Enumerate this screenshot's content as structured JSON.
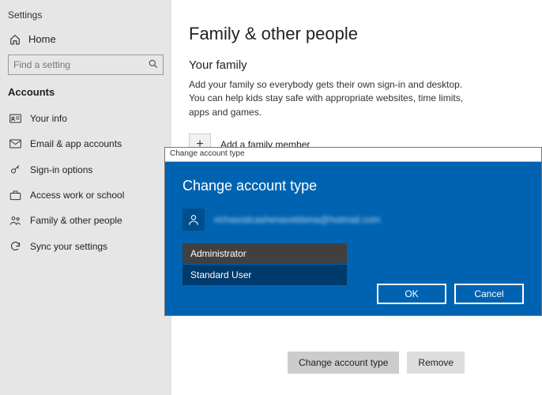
{
  "app_title": "Settings",
  "home_label": "Home",
  "search": {
    "placeholder": "Find a setting"
  },
  "section": "Accounts",
  "nav": [
    {
      "label": "Your info"
    },
    {
      "label": "Email & app accounts"
    },
    {
      "label": "Sign-in options"
    },
    {
      "label": "Access work or school"
    },
    {
      "label": "Family & other people"
    },
    {
      "label": "Sync your settings"
    }
  ],
  "page": {
    "title": "Family & other people",
    "subtitle": "Your family",
    "description": "Add your family so everybody gets their own sign-in and desktop. You can help kids stay safe with appropriate websites, time limits, apps and games.",
    "add_label": "Add a family member"
  },
  "account_actions": {
    "change_type": "Change account type",
    "remove": "Remove"
  },
  "dialog": {
    "titlebar": "Change account type",
    "heading": "Change account type",
    "user_email": "richasodcashenavebbma@hotmail.com",
    "options": {
      "admin": "Administrator",
      "standard": "Standard User"
    },
    "ok": "OK",
    "cancel": "Cancel"
  }
}
